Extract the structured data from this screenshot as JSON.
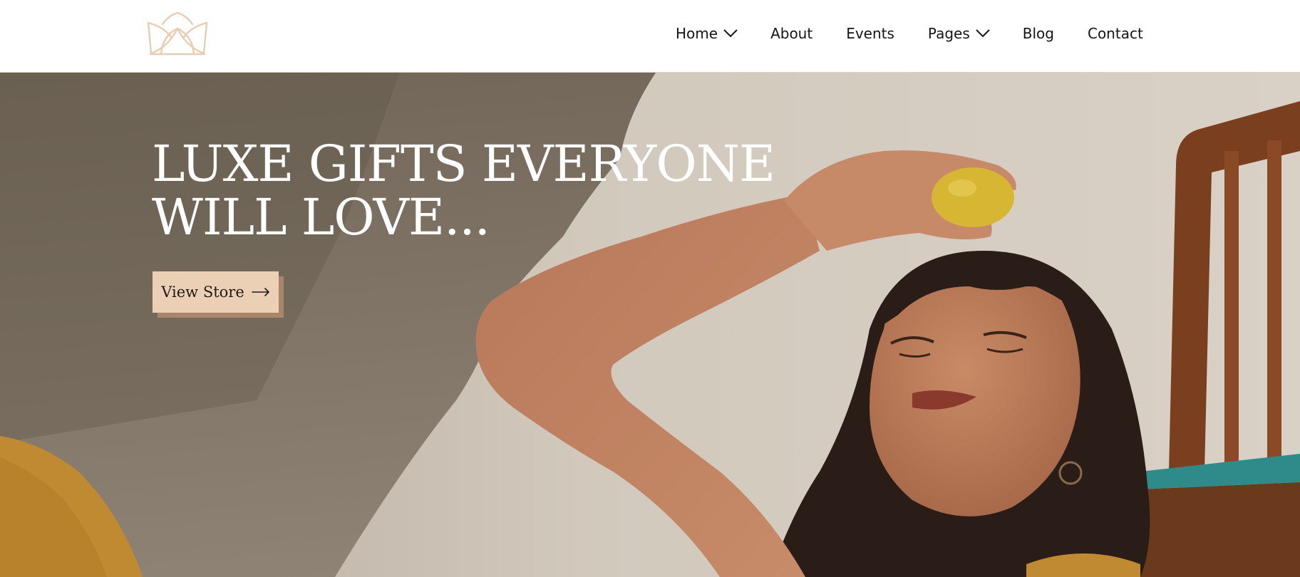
{
  "header": {
    "logo_icon": "lotus-icon",
    "logo_color": "#e8cdb2",
    "nav": [
      {
        "label": "Home",
        "has_dropdown": true
      },
      {
        "label": "About",
        "has_dropdown": false
      },
      {
        "label": "Events",
        "has_dropdown": false
      },
      {
        "label": "Pages",
        "has_dropdown": true
      },
      {
        "label": "Blog",
        "has_dropdown": false
      },
      {
        "label": "Contact",
        "has_dropdown": false
      }
    ]
  },
  "hero": {
    "title_line1": "LUXE GIFTS EVERYONE",
    "title_line2": "WILL LOVE...",
    "cta_label": "View Store",
    "cta_icon": "arrow-right-icon",
    "cta_color": "#ecd0b6",
    "cta_shadow_color": "#a9866a"
  }
}
